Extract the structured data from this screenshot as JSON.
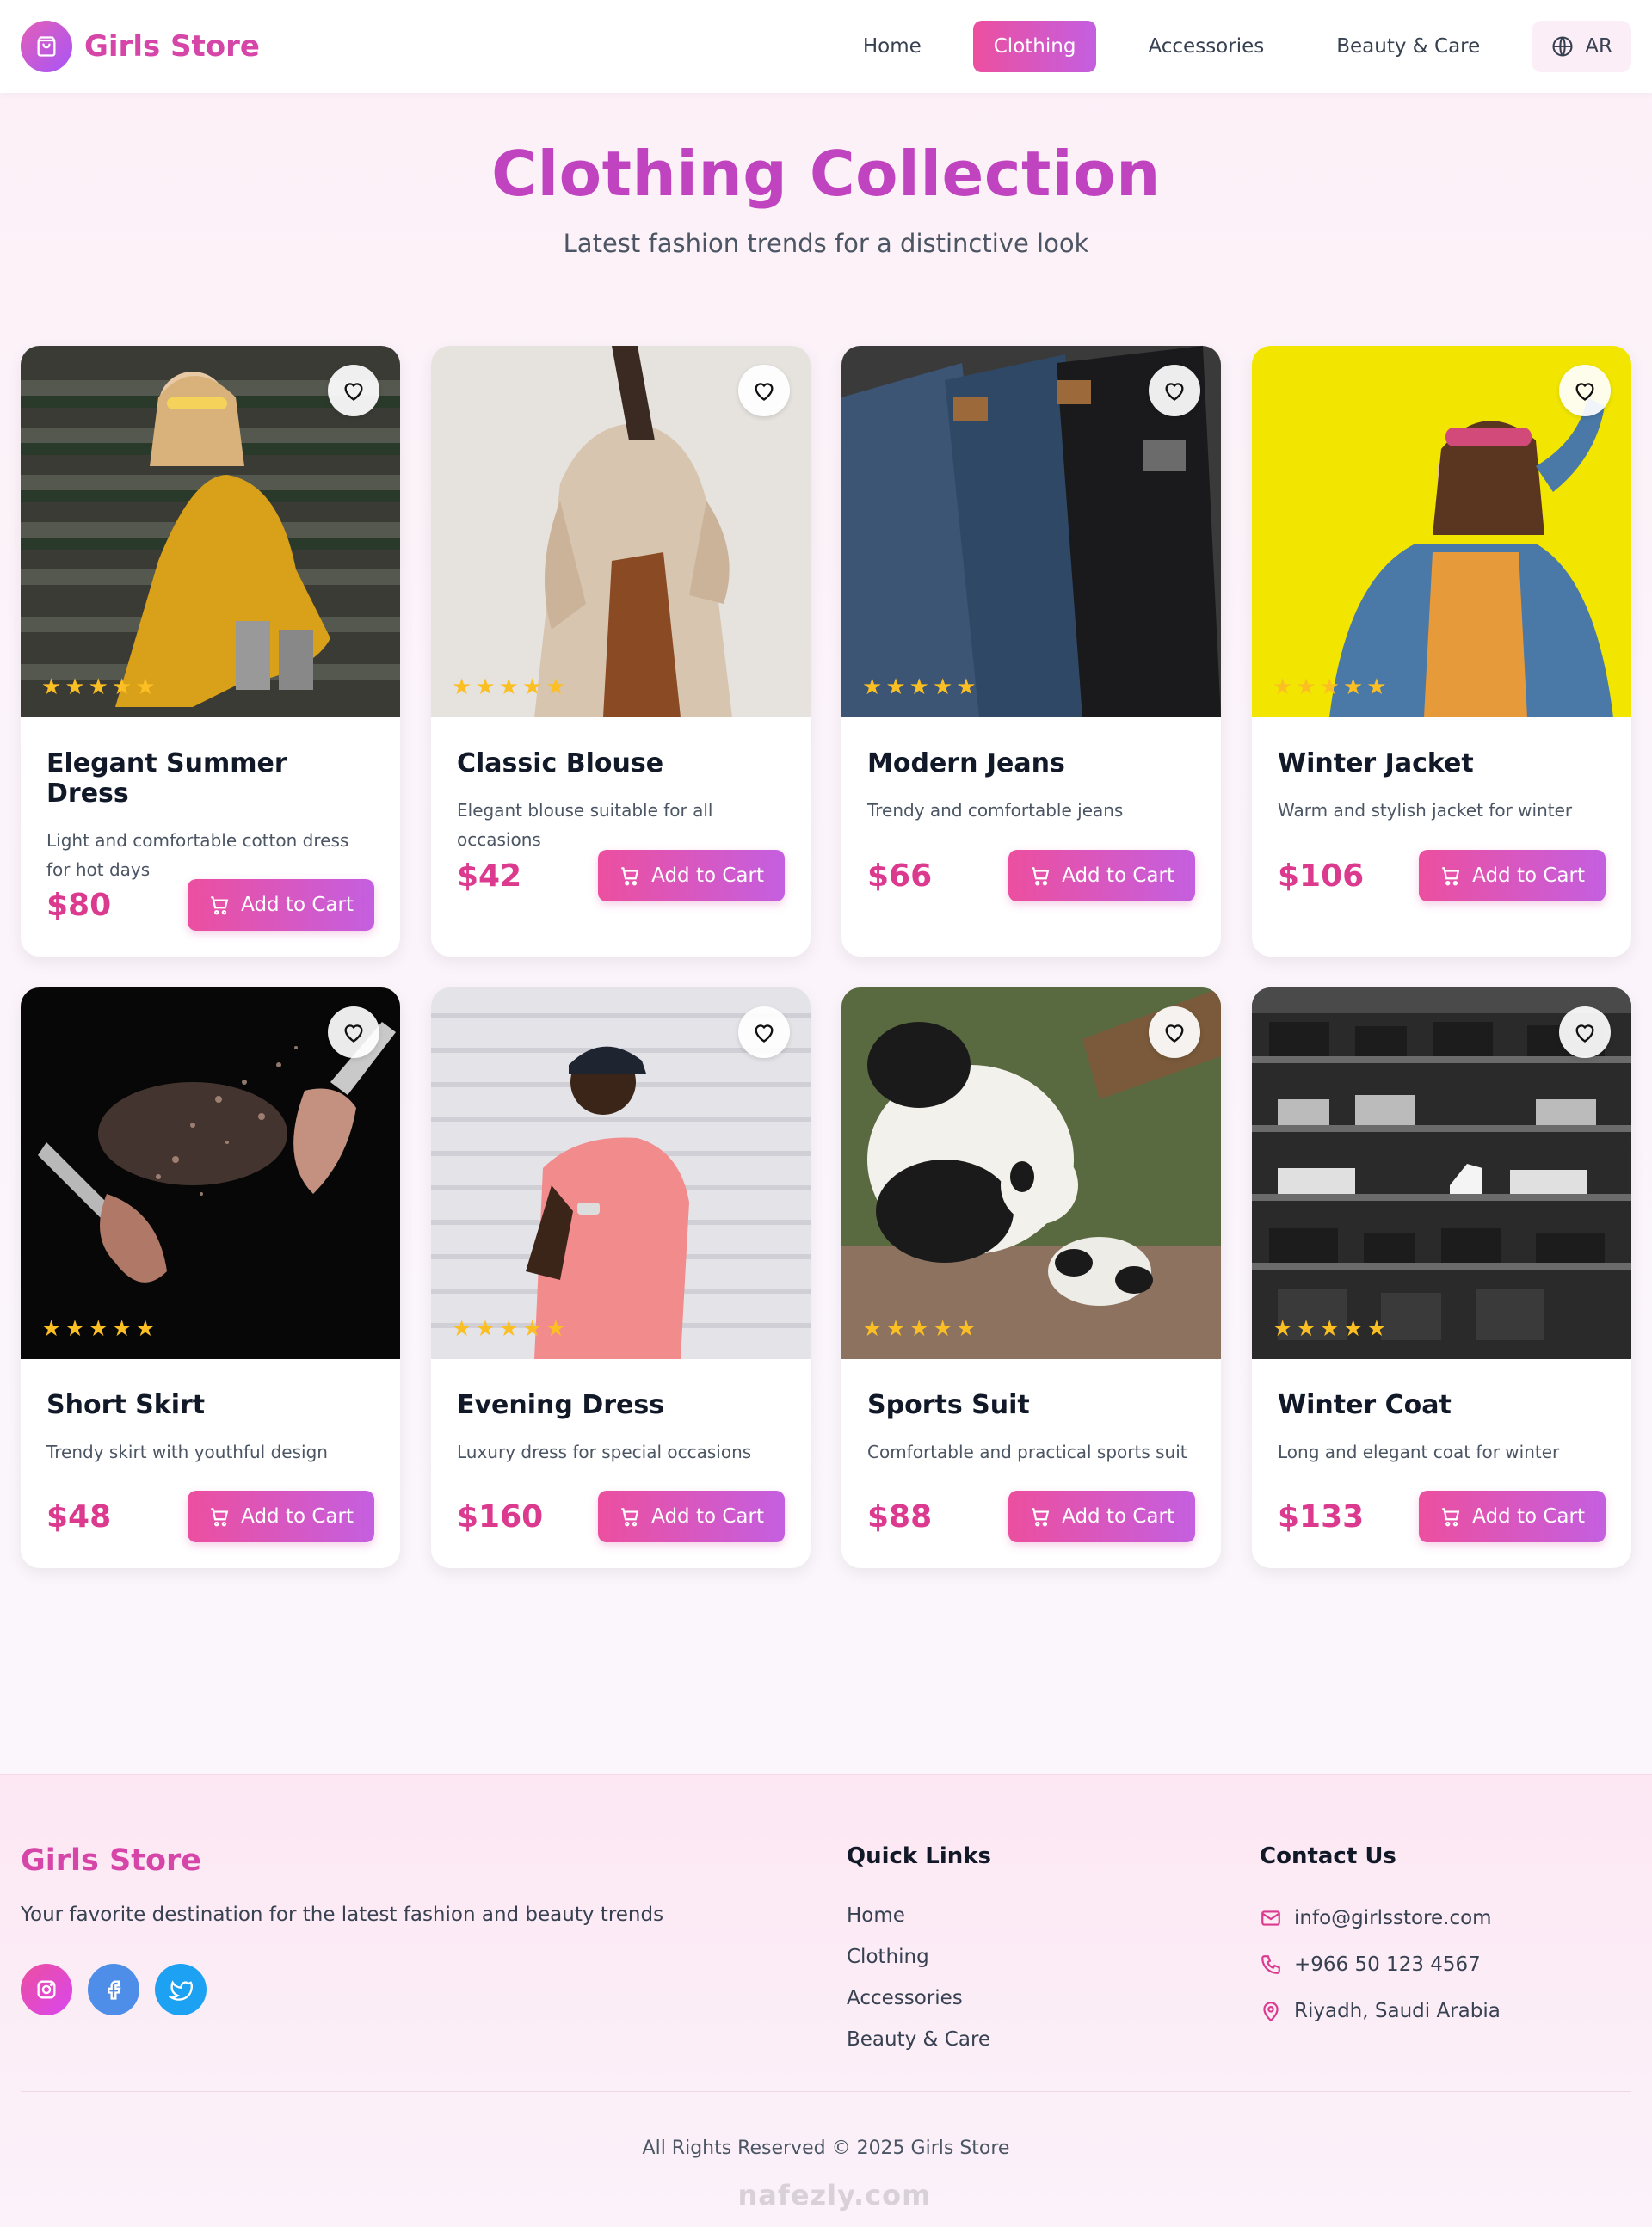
{
  "nav": {
    "brand": "Girls Store",
    "links": [
      "Home",
      "Clothing",
      "Accessories",
      "Beauty & Care"
    ],
    "active": "Clothing",
    "lang": "AR"
  },
  "hero": {
    "title": "Clothing Collection",
    "subtitle": "Latest fashion trends for a distinctive look"
  },
  "products": [
    {
      "title": "Elegant Summer Dress",
      "desc": "Light and comfortable cotton dress for hot days",
      "price": "$80",
      "cart": "Add to Cart",
      "rating": 5,
      "image": "woman-yellow-dress-on-stairs"
    },
    {
      "title": "Classic Blouse",
      "desc": "Elegant blouse suitable for all occasions",
      "price": "$42",
      "cart": "Add to Cart",
      "rating": 5,
      "image": "woman-beige-blouse"
    },
    {
      "title": "Modern Jeans",
      "desc": "Trendy and comfortable jeans",
      "price": "$66",
      "cart": "Add to Cart",
      "rating": 5,
      "image": "folded-jeans"
    },
    {
      "title": "Winter Jacket",
      "desc": "Warm and stylish jacket for winter",
      "price": "$106",
      "cart": "Add to Cart",
      "rating": 5,
      "image": "woman-denim-jacket-yellow-bg"
    },
    {
      "title": "Short Skirt",
      "desc": "Trendy skirt with youthful design",
      "price": "$48",
      "cart": "Add to Cart",
      "rating": 5,
      "image": "makeup-brushes-powder"
    },
    {
      "title": "Evening Dress",
      "desc": "Luxury dress for special occasions",
      "price": "$160",
      "cart": "Add to Cart",
      "rating": 5,
      "image": "man-pink-tshirt"
    },
    {
      "title": "Sports Suit",
      "desc": "Comfortable and practical sports suit",
      "price": "$88",
      "cart": "Add to Cart",
      "rating": 5,
      "image": "panda-with-cub"
    },
    {
      "title": "Winter Coat",
      "desc": "Long and elegant coat for winter",
      "price": "$133",
      "cart": "Add to Cart",
      "rating": 5,
      "image": "clothing-shelves"
    }
  ],
  "footer": {
    "brand": "Girls Store",
    "tagline": "Your favorite destination for the latest fashion and beauty trends",
    "quick_title": "Quick Links",
    "quick_links": [
      "Home",
      "Clothing",
      "Accessories",
      "Beauty & Care"
    ],
    "contact_title": "Contact Us",
    "email": "info@girlsstore.com",
    "phone": "+966 50 123 4567",
    "address": "Riyadh, Saudi Arabia",
    "copyright": "All Rights Reserved © 2025 Girls Store",
    "watermark": "nafezly.com"
  },
  "colors": {
    "brand": "#d646a8",
    "accent_gradient_start": "#ec4f9f",
    "accent_gradient_end": "#c45fe0",
    "price": "#db3a8f",
    "star": "#fbbf24"
  }
}
